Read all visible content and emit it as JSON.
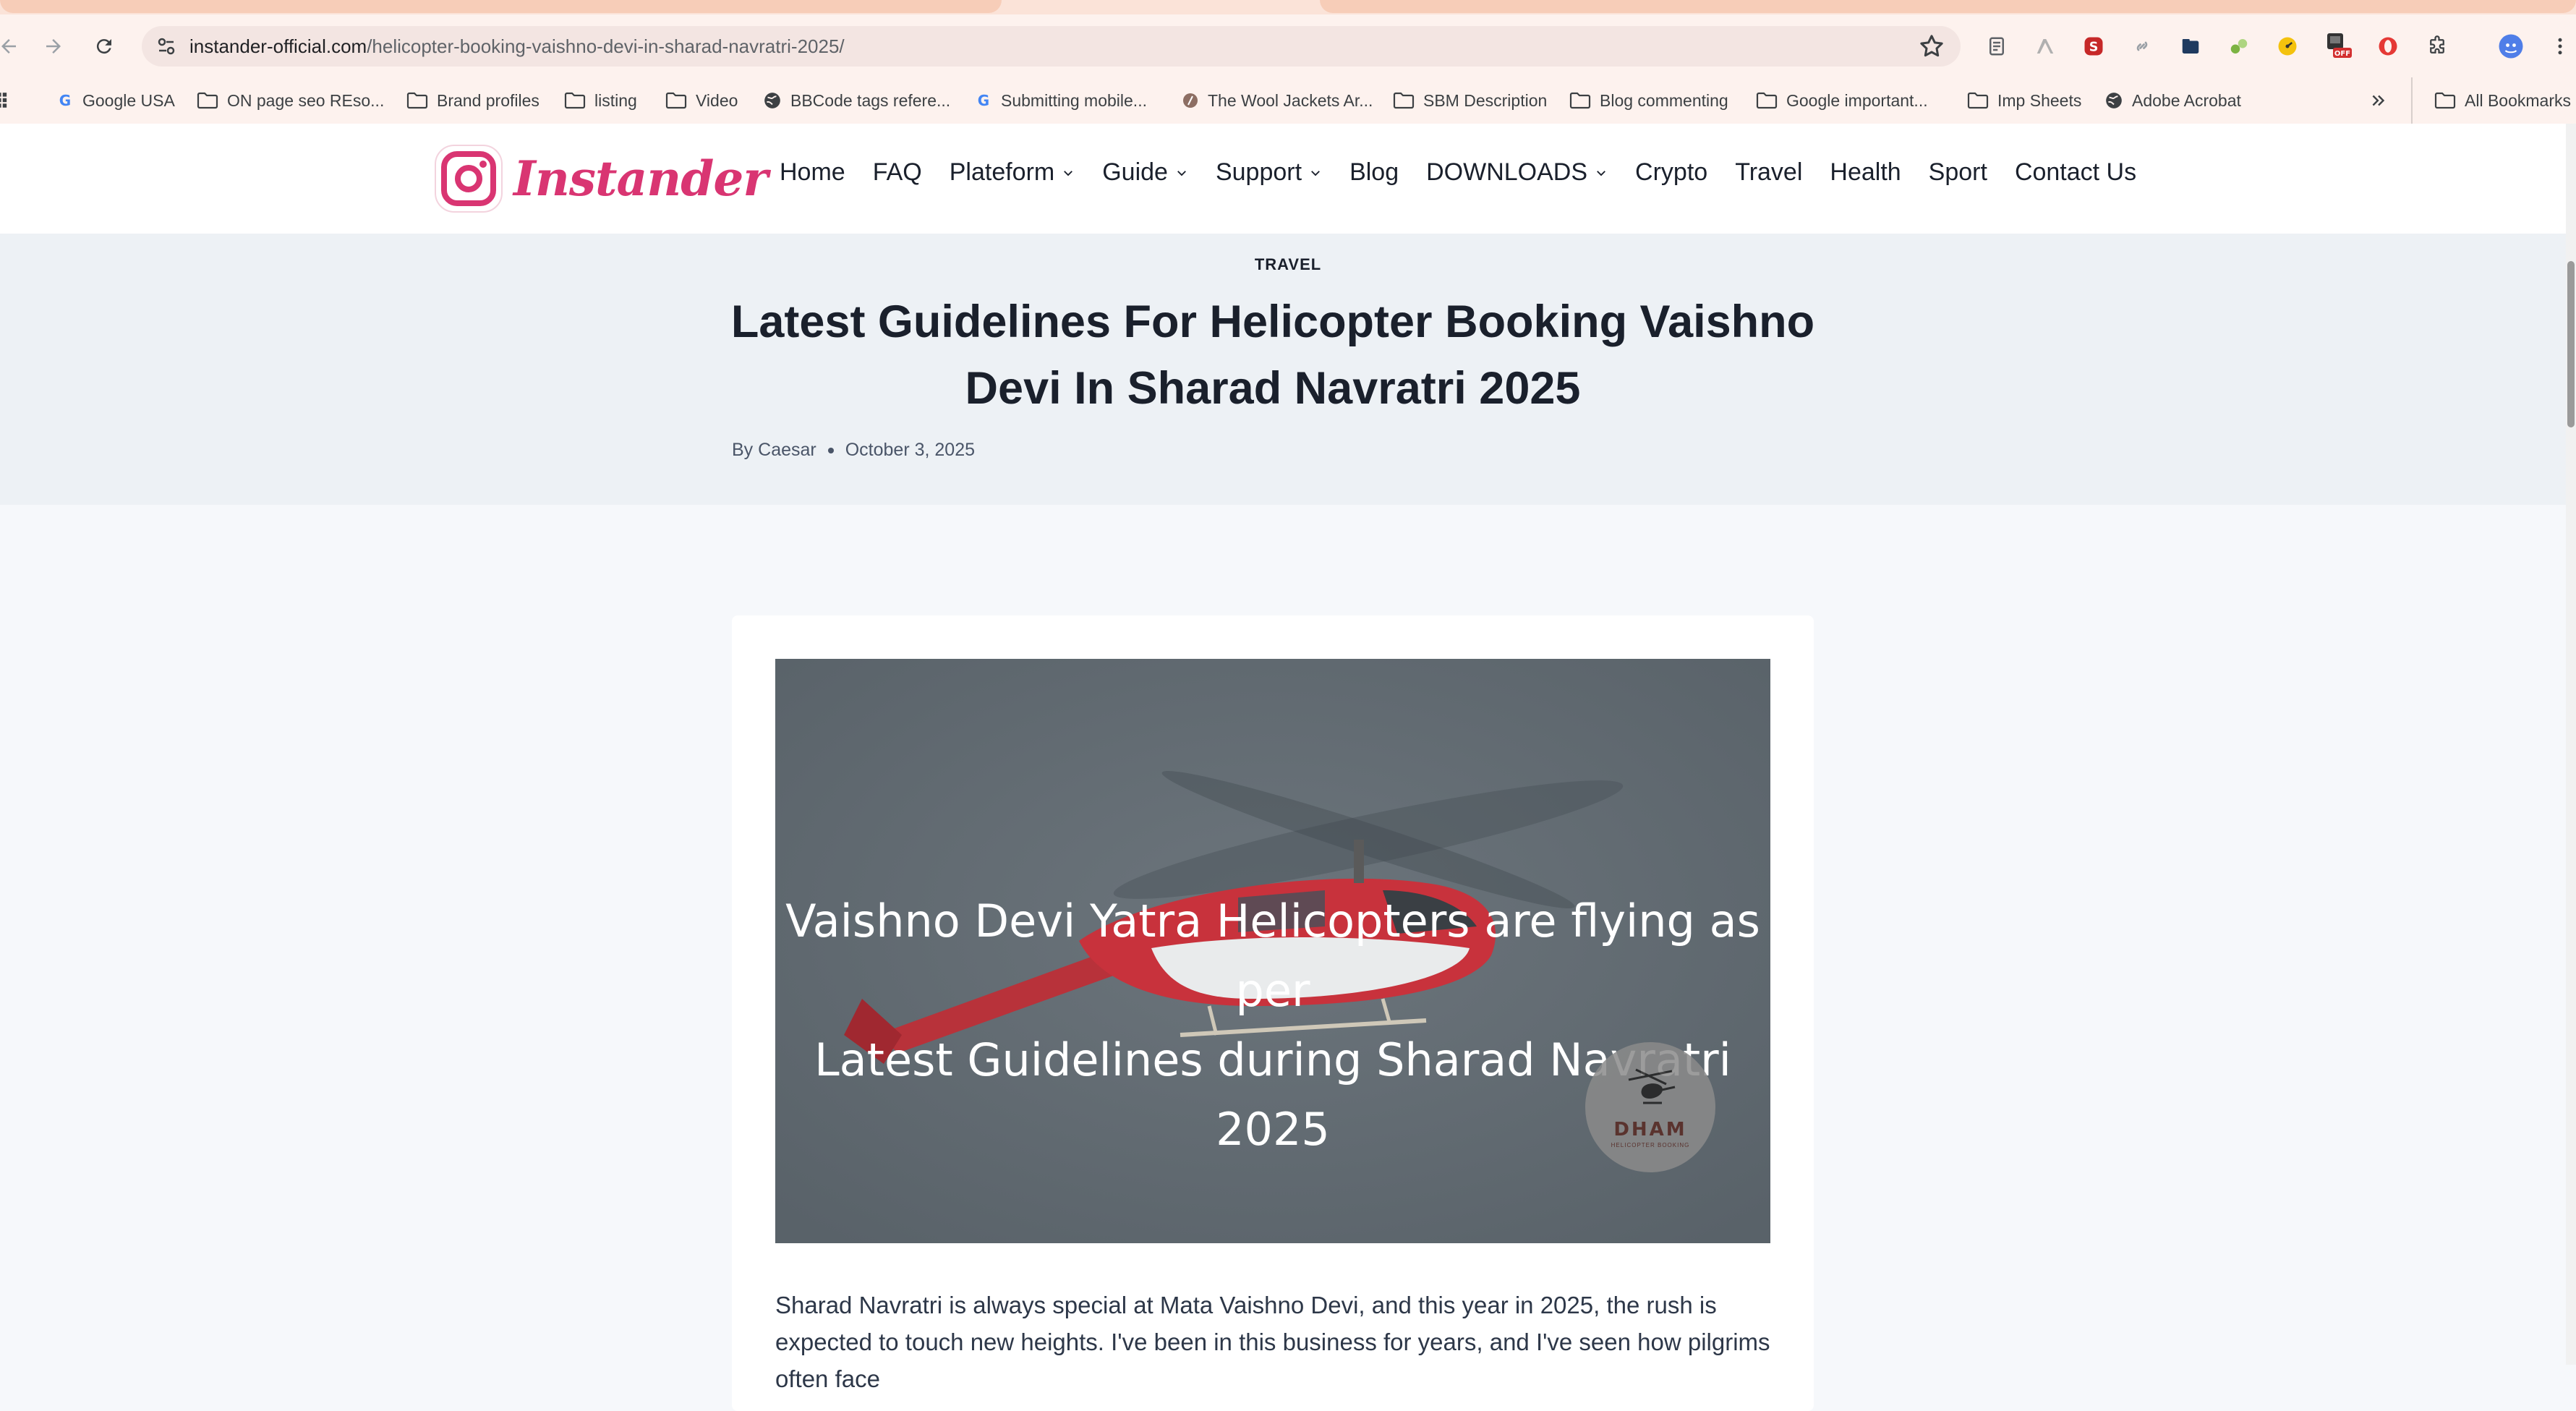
{
  "browser": {
    "url_host": "instander-official.com",
    "url_path": "/helicopter-booking-vaishno-devi-in-sharad-navratri-2025/",
    "bookmarks": [
      {
        "label": "Google USA",
        "icon": "google-icon"
      },
      {
        "label": "ON page seo REso...",
        "icon": "folder-icon"
      },
      {
        "label": "Brand profiles",
        "icon": "folder-icon"
      },
      {
        "label": "listing",
        "icon": "folder-icon"
      },
      {
        "label": "Video",
        "icon": "folder-icon"
      },
      {
        "label": "BBCode tags refere...",
        "icon": "globe-icon"
      },
      {
        "label": "Submitting mobile...",
        "icon": "google-icon"
      },
      {
        "label": "The Wool Jackets Ar...",
        "icon": "site-icon"
      },
      {
        "label": "SBM Description",
        "icon": "folder-icon"
      },
      {
        "label": "Blog commenting",
        "icon": "folder-icon"
      },
      {
        "label": "Google important...",
        "icon": "folder-icon"
      },
      {
        "label": "Imp Sheets",
        "icon": "folder-icon"
      },
      {
        "label": "Adobe Acrobat",
        "icon": "globe-icon"
      }
    ],
    "all_bookmarks": "All Bookmarks",
    "extension_badge": "OFF"
  },
  "site": {
    "logo_text": "Instander",
    "nav": [
      {
        "label": "Home",
        "dropdown": false
      },
      {
        "label": "FAQ",
        "dropdown": false
      },
      {
        "label": "Plateform",
        "dropdown": true
      },
      {
        "label": "Guide",
        "dropdown": true
      },
      {
        "label": "Support",
        "dropdown": true
      },
      {
        "label": "Blog",
        "dropdown": false
      },
      {
        "label": "DOWNLOADS",
        "dropdown": true
      },
      {
        "label": "Crypto",
        "dropdown": false
      },
      {
        "label": "Travel",
        "dropdown": false
      },
      {
        "label": "Health",
        "dropdown": false
      },
      {
        "label": "Sport",
        "dropdown": false
      },
      {
        "label": "Contact Us",
        "dropdown": false
      }
    ]
  },
  "post": {
    "category": "TRAVEL",
    "title": "Latest Guidelines For Helicopter Booking Vaishno Devi In Sharad Navratri 2025",
    "author_prefix": "By",
    "author": "Caesar",
    "date": "October 3, 2025",
    "image_caption_line1": "Vaishno Devi Yatra Helicopters are flying as per",
    "image_caption_line2": "Latest Guidelines during Sharad Navratri 2025",
    "image_badge": "DHAM",
    "image_badge_sub": "HELICOPTER BOOKING",
    "intro": "Sharad Navratri is always special at Mata Vaishno Devi, and this year in 2025, the rush is expected to touch new heights. I've been in this business for years, and I've seen how pilgrims often face"
  },
  "colors": {
    "brand_pink": "#d93572",
    "hero_bg": "#edf1f5",
    "page_bg": "#f6f8fb",
    "chrome_bg": "#fdf2ee"
  }
}
